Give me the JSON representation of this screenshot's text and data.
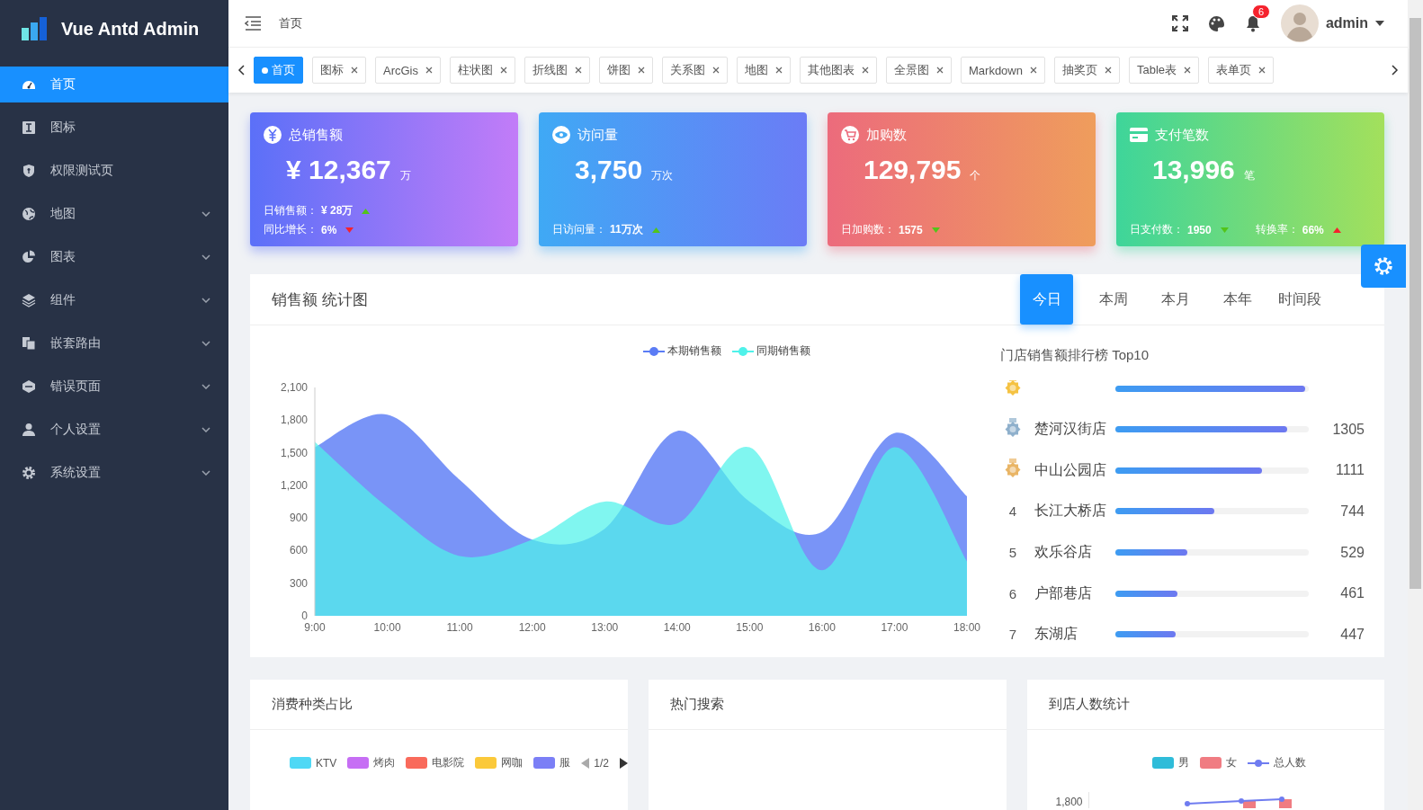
{
  "sidebar": {
    "logo_text": "Vue Antd Admin",
    "items": [
      {
        "label": "首页",
        "selected": true,
        "has_submenu": false
      },
      {
        "label": "图标",
        "selected": false,
        "has_submenu": false
      },
      {
        "label": "权限测试页",
        "selected": false,
        "has_submenu": false
      },
      {
        "label": "地图",
        "selected": false,
        "has_submenu": true
      },
      {
        "label": "图表",
        "selected": false,
        "has_submenu": true
      },
      {
        "label": "组件",
        "selected": false,
        "has_submenu": true
      },
      {
        "label": "嵌套路由",
        "selected": false,
        "has_submenu": true
      },
      {
        "label": "错误页面",
        "selected": false,
        "has_submenu": true
      },
      {
        "label": "个人设置",
        "selected": false,
        "has_submenu": true
      },
      {
        "label": "系统设置",
        "selected": false,
        "has_submenu": true
      }
    ]
  },
  "header": {
    "breadcrumb": "首页",
    "notification_count": "6",
    "user": "admin"
  },
  "tabs": [
    {
      "label": "首页",
      "selected": true
    },
    {
      "label": "图标",
      "selected": false
    },
    {
      "label": "ArcGis",
      "selected": false
    },
    {
      "label": "柱状图",
      "selected": false
    },
    {
      "label": "折线图",
      "selected": false
    },
    {
      "label": "饼图",
      "selected": false
    },
    {
      "label": "关系图",
      "selected": false
    },
    {
      "label": "地图",
      "selected": false
    },
    {
      "label": "其他图表",
      "selected": false
    },
    {
      "label": "全景图",
      "selected": false
    },
    {
      "label": "Markdown",
      "selected": false
    },
    {
      "label": "抽奖页",
      "selected": false
    },
    {
      "label": "Table表",
      "selected": false
    },
    {
      "label": "表单页",
      "selected": false
    }
  ],
  "stat_cards": [
    {
      "title": "总销售额",
      "value": "¥ 12,367",
      "unit": "万",
      "stats": [
        {
          "label": "日销售额：",
          "value": "¥ 28万",
          "rising": true,
          "color": "#52c41a"
        },
        {
          "label": "同比增长：",
          "value": "6%",
          "rising": false,
          "color": "#f5222d"
        }
      ]
    },
    {
      "title": "访问量",
      "value": "3,750",
      "unit": "万次",
      "stats": [
        {
          "label": "日访问量：",
          "value": "11万次",
          "rising": true,
          "color": "#52c41a"
        }
      ]
    },
    {
      "title": "加购数",
      "value": "129,795",
      "unit": "个",
      "stats": [
        {
          "label": "日加购数：",
          "value": "1575",
          "rising": false,
          "color": "#52c41a"
        }
      ]
    },
    {
      "title": "支付笔数",
      "value": "13,996",
      "unit": "笔",
      "stats": [
        {
          "label": "日支付数：",
          "value": "1950",
          "rising": false,
          "color": "#52c41a"
        },
        {
          "label": "转换率：",
          "value": "66%",
          "rising": true,
          "color": "#f5222d"
        }
      ]
    }
  ],
  "sales_panel": {
    "title": "销售额 统计图",
    "periods": [
      {
        "label": "今日",
        "selected": true
      },
      {
        "label": "本周",
        "selected": false
      },
      {
        "label": "本月",
        "selected": false
      },
      {
        "label": "本年",
        "selected": false
      },
      {
        "label": "时间段",
        "selected": false
      }
    ],
    "chart_data": {
      "type": "area",
      "legend": "top",
      "categories": [
        "9:00",
        "10:00",
        "11:00",
        "12:00",
        "13:00",
        "14:00",
        "15:00",
        "16:00",
        "17:00",
        "18:00"
      ],
      "series": [
        {
          "name": "本期销售额",
          "color": "#5b7cf5",
          "values": [
            1550,
            1850,
            1250,
            700,
            800,
            1700,
            1050,
            770,
            1680,
            1100
          ]
        },
        {
          "name": "同期销售额",
          "color": "#4ff2ea",
          "values": [
            1600,
            1000,
            550,
            700,
            1050,
            850,
            1550,
            420,
            1550,
            500
          ]
        }
      ],
      "ylim": [
        0,
        2100
      ],
      "yticks": [
        {
          "value": 0,
          "label": "0"
        },
        {
          "value": 300,
          "label": "300"
        },
        {
          "value": 600,
          "label": "600"
        },
        {
          "value": 900,
          "label": "900"
        },
        {
          "value": 1200,
          "label": "1,200"
        },
        {
          "value": 1500,
          "label": "1,500"
        },
        {
          "value": 1800,
          "label": "1,800"
        },
        {
          "value": 2100,
          "label": "2,100"
        }
      ]
    },
    "ranking": {
      "title": "门店销售额排行榜 Top10",
      "rows": [
        {
          "kind": "medal",
          "level": 0.98
        },
        {
          "kind": "medal",
          "name": "楚河汉街店",
          "value": "1305",
          "level": 0.89
        },
        {
          "kind": "medal",
          "name": "中山公园店",
          "value": "1111",
          "level": 0.76
        },
        {
          "kind": "number",
          "rank": "4",
          "name": "长江大桥店",
          "value": "744",
          "level": 0.51
        },
        {
          "kind": "number",
          "rank": "5",
          "name": "欢乐谷店",
          "value": "529",
          "level": 0.37
        },
        {
          "kind": "number",
          "rank": "6",
          "name": "户部巷店",
          "value": "461",
          "level": 0.32
        },
        {
          "kind": "number",
          "rank": "7",
          "name": "东湖店",
          "value": "447",
          "level": 0.31
        }
      ]
    }
  },
  "category_panel": {
    "title": "消费种类占比",
    "legend": [
      {
        "label": "KTV",
        "color": "#4fd8f5"
      },
      {
        "label": "烤肉",
        "color": "#c66ef4"
      },
      {
        "label": "电影院",
        "color": "#f96a5b"
      },
      {
        "label": "网咖",
        "color": "#fbc93a"
      },
      {
        "label": "服",
        "color": "#7b7ff6"
      }
    ],
    "page": "1/2"
  },
  "hot_search_panel": {
    "title": "热门搜索"
  },
  "visitor_panel": {
    "title": "到店人数统计",
    "legend": [
      {
        "label": "男",
        "color": "#2fbcd9",
        "kind": "bar"
      },
      {
        "label": "女",
        "color": "#f07c82",
        "kind": "bar"
      },
      {
        "label": "总人数",
        "color": "#6f7cf0",
        "kind": "line"
      }
    ],
    "ytick": "1,800"
  }
}
